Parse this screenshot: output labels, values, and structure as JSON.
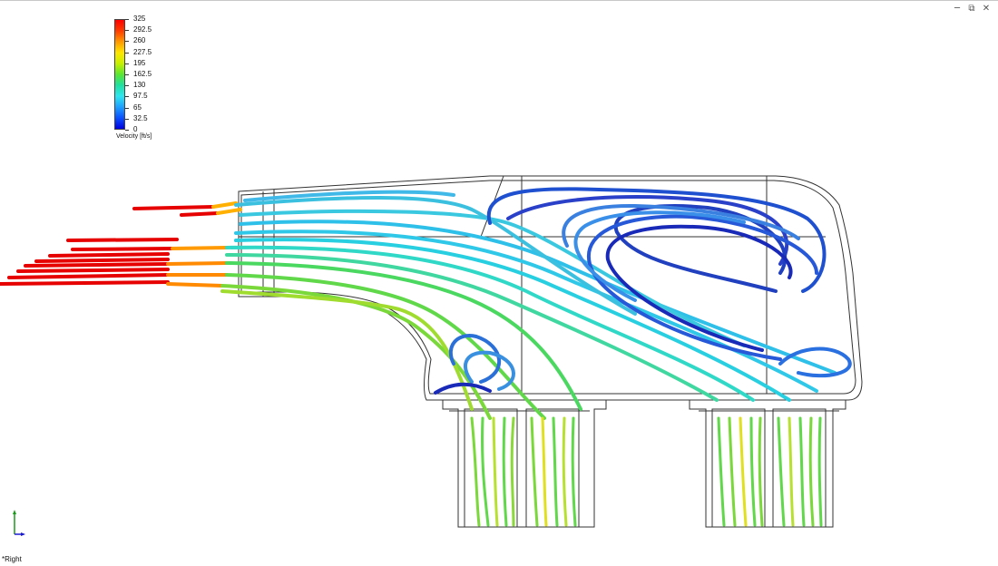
{
  "window_controls": {
    "minimize": "─",
    "restore": "⧉",
    "close": "✕"
  },
  "legend": {
    "labels": [
      "325",
      "292.5",
      "260",
      "227.5",
      "195",
      "162.5",
      "130",
      "97.5",
      "65",
      "32.5",
      "0"
    ],
    "title": "Velocity [ft/s]"
  },
  "view": {
    "label": "*Right"
  },
  "colors": {
    "housing_outline": "#333333",
    "background": "#ffffff"
  }
}
